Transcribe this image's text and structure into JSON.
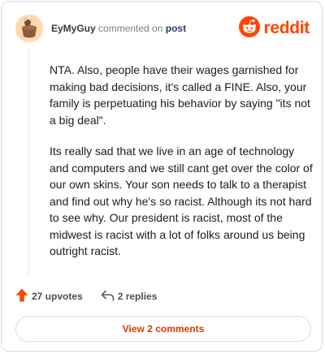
{
  "comment": {
    "username": "EyMyGuy",
    "action_text": "commented on",
    "post_link_text": "post",
    "paragraphs": [
      "NTA. Also, people have their wages garnished for making bad decisions, it's called a FINE. Also, your family is perpetuating his behavior by saying \"its not a big deal\".",
      "Its really sad that we live in an age of technology and computers and we still cant get over the color of our own skins. Your son needs to talk to a therapist and find out why he's so racist. Although its not hard to see why. Our president is racist, most of the midwest is racist with a lot of folks around us being outright racist."
    ]
  },
  "brand": {
    "wordmark": "reddit",
    "color": "#ff4500"
  },
  "actions": {
    "upvotes_label": "27 upvotes",
    "replies_label": "2 replies",
    "upvote_color": "#ff4500"
  },
  "view_comments_label": "View 2 comments",
  "icons": {
    "avatar": "user-avatar",
    "logo": "reddit-logo-icon",
    "upvote": "upvote-arrow-icon",
    "reply": "reply-arrow-icon"
  }
}
